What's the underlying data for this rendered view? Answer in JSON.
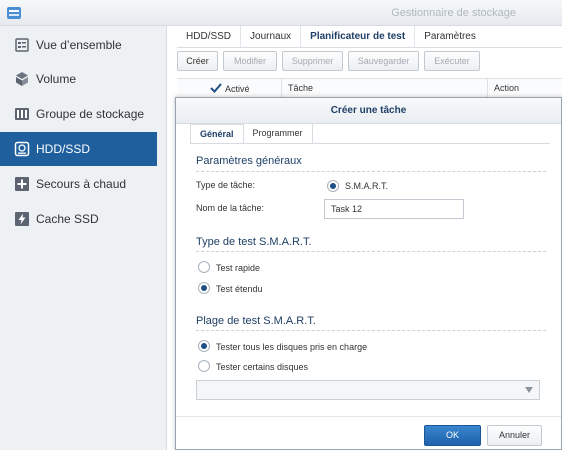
{
  "window": {
    "title": "Gestionnaire de stockage"
  },
  "sidebar": {
    "items": [
      {
        "label": "Vue d’ensemble",
        "icon": "overview-icon"
      },
      {
        "label": "Volume",
        "icon": "volume-icon"
      },
      {
        "label": "Groupe de stockage",
        "icon": "storage-pool-icon"
      },
      {
        "label": "HDD/SSD",
        "icon": "hdd-icon",
        "active": true
      },
      {
        "label": "Secours à chaud",
        "icon": "hot-spare-icon"
      },
      {
        "label": "Cache SSD",
        "icon": "ssd-cache-icon"
      }
    ]
  },
  "main": {
    "tabs": [
      {
        "label": "HDD/SSD"
      },
      {
        "label": "Journaux"
      },
      {
        "label": "Planificateur de test",
        "active": true
      },
      {
        "label": "Paramètres"
      }
    ],
    "toolbar": {
      "create": "Créer",
      "modify": "Modifier",
      "delete": "Supprimer",
      "save": "Sauvegarder",
      "execute": "Exécuter"
    },
    "grid": {
      "col_enabled": "Activé",
      "col_task": "Tâche",
      "col_action": "Action"
    }
  },
  "dialog": {
    "title": "Créer une tâche",
    "tabs": [
      {
        "label": "Général",
        "active": true
      },
      {
        "label": "Programmer"
      }
    ],
    "general_section": "Paramètres généraux",
    "task_type_label": "Type de tâche:",
    "task_type_value": "S.M.A.R.T.",
    "task_name_label": "Nom de la tâche:",
    "task_name_value": "Task 12",
    "test_type_section": "Type de test S.M.A.R.T.",
    "quick_test": "Test rapide",
    "extended_test": "Test étendu",
    "range_section": "Plage de test S.M.A.R.T.",
    "all_disks": "Tester tous les disques pris en charge",
    "some_disks": "Tester certains disques",
    "ok": "OK",
    "cancel": "Annuler"
  },
  "colors": {
    "accent": "#1f5f9e",
    "primary_button": "#2a74bf"
  }
}
